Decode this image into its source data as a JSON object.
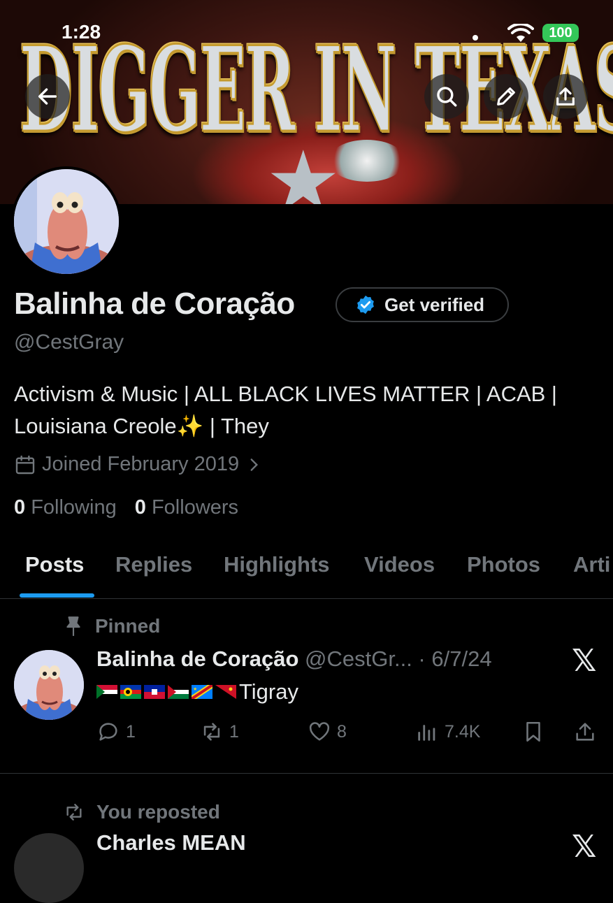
{
  "status_bar": {
    "time": "1:28",
    "battery": "100"
  },
  "banner": {
    "text": "DIGGER IN TEXAS"
  },
  "profile": {
    "name": "Balinha de Coração",
    "get_verified_label": "Get verified",
    "handle": "@CestGray",
    "bio_line1": "Activism & Music | ALL BLACK LIVES MATTER | ACAB |",
    "bio_line2": "Louisiana Creole✨ | They",
    "joined": "Joined February 2019",
    "following_count": "0",
    "following_label": "Following",
    "followers_count": "0",
    "followers_label": "Followers"
  },
  "tabs": [
    {
      "label": "Posts",
      "active": true
    },
    {
      "label": "Replies"
    },
    {
      "label": "Highlights"
    },
    {
      "label": "Videos"
    },
    {
      "label": "Photos"
    },
    {
      "label": "Arti"
    }
  ],
  "pinned_post": {
    "pinned_label": "Pinned",
    "author_name": "Balinha de Coração",
    "meta": "@CestGr... · 6/7/24",
    "text": "Tigray",
    "replies": "1",
    "reposts": "1",
    "likes": "8",
    "views": "7.4K"
  },
  "next_post": {
    "repost_label": "You reposted",
    "author_name": "Charles MEAN"
  },
  "colors": {
    "accent": "#1d9bf0",
    "muted": "#71767b",
    "text": "#e7e9ea",
    "background": "#000000",
    "battery": "#34c759"
  }
}
